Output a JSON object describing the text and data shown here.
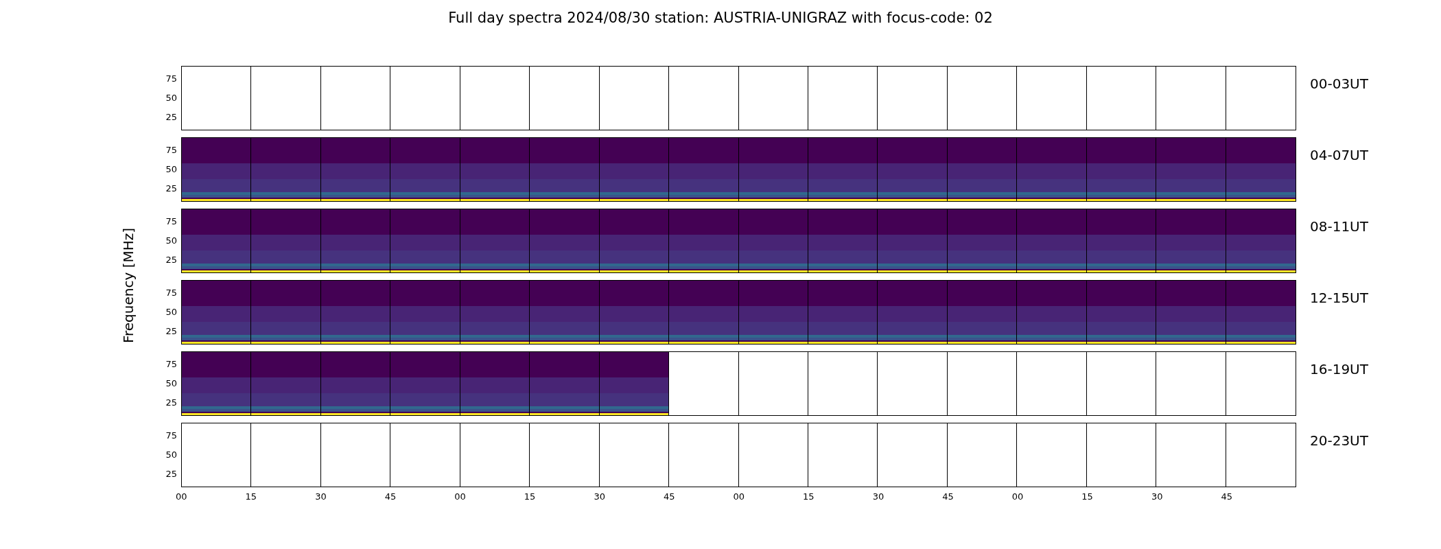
{
  "title": "Full day spectra 2024/08/30 station: AUSTRIA-UNIGRAZ with focus-code: 02",
  "ylabel": "Frequency [MHz]",
  "rows": [
    {
      "label": "00-03UT",
      "yticks": [
        "75",
        "50",
        "25"
      ],
      "panels": [
        {
          "kind": "empty"
        },
        {
          "kind": "empty"
        },
        {
          "kind": "empty"
        },
        {
          "kind": "empty"
        },
        {
          "kind": "empty"
        },
        {
          "kind": "empty"
        },
        {
          "kind": "empty"
        },
        {
          "kind": "empty"
        },
        {
          "kind": "empty"
        },
        {
          "kind": "empty"
        },
        {
          "kind": "empty"
        },
        {
          "kind": "empty"
        },
        {
          "kind": "empty"
        },
        {
          "kind": "empty"
        },
        {
          "kind": "empty"
        },
        {
          "kind": "empty"
        }
      ]
    },
    {
      "label": "04-07UT",
      "yticks": [
        "75",
        "50",
        "25"
      ],
      "panels": [
        {
          "kind": "spectrum"
        },
        {
          "kind": "spectrum"
        },
        {
          "kind": "spectrum"
        },
        {
          "kind": "spectrum"
        },
        {
          "kind": "spectrum"
        },
        {
          "kind": "spectrum"
        },
        {
          "kind": "spectrum"
        },
        {
          "kind": "spectrum"
        },
        {
          "kind": "spectrum"
        },
        {
          "kind": "spectrum"
        },
        {
          "kind": "spectrum"
        },
        {
          "kind": "spectrum"
        },
        {
          "kind": "spectrum"
        },
        {
          "kind": "spectrum"
        },
        {
          "kind": "spectrum"
        },
        {
          "kind": "spectrum"
        }
      ]
    },
    {
      "label": "08-11UT",
      "yticks": [
        "75",
        "50",
        "25"
      ],
      "panels": [
        {
          "kind": "spectrum"
        },
        {
          "kind": "spectrum"
        },
        {
          "kind": "spectrum"
        },
        {
          "kind": "spectrum"
        },
        {
          "kind": "spectrum"
        },
        {
          "kind": "spectrum"
        },
        {
          "kind": "spectrum"
        },
        {
          "kind": "spectrum"
        },
        {
          "kind": "spectrum"
        },
        {
          "kind": "spectrum"
        },
        {
          "kind": "spectrum"
        },
        {
          "kind": "spectrum"
        },
        {
          "kind": "spectrum"
        },
        {
          "kind": "spectrum"
        },
        {
          "kind": "spectrum"
        },
        {
          "kind": "spectrum"
        }
      ]
    },
    {
      "label": "12-15UT",
      "yticks": [
        "75",
        "50",
        "25"
      ],
      "panels": [
        {
          "kind": "spectrum"
        },
        {
          "kind": "spectrum"
        },
        {
          "kind": "spectrum"
        },
        {
          "kind": "spectrum"
        },
        {
          "kind": "spectrum"
        },
        {
          "kind": "spectrum"
        },
        {
          "kind": "spectrum"
        },
        {
          "kind": "spectrum"
        },
        {
          "kind": "spectrum"
        },
        {
          "kind": "spectrum"
        },
        {
          "kind": "spectrum"
        },
        {
          "kind": "spectrum"
        },
        {
          "kind": "spectrum"
        },
        {
          "kind": "spectrum"
        },
        {
          "kind": "spectrum"
        },
        {
          "kind": "spectrum"
        }
      ]
    },
    {
      "label": "16-19UT",
      "yticks": [
        "75",
        "50",
        "25"
      ],
      "panels": [
        {
          "kind": "spectrum"
        },
        {
          "kind": "spectrum"
        },
        {
          "kind": "spectrum"
        },
        {
          "kind": "spectrum"
        },
        {
          "kind": "spectrum"
        },
        {
          "kind": "spectrum"
        },
        {
          "kind": "spectrum"
        },
        {
          "kind": "empty"
        },
        {
          "kind": "empty"
        },
        {
          "kind": "empty"
        },
        {
          "kind": "empty"
        },
        {
          "kind": "empty"
        },
        {
          "kind": "empty"
        },
        {
          "kind": "empty"
        },
        {
          "kind": "empty"
        },
        {
          "kind": "empty"
        }
      ]
    },
    {
      "label": "20-23UT",
      "yticks": [
        "75",
        "50",
        "25"
      ],
      "panels": [
        {
          "kind": "empty"
        },
        {
          "kind": "empty"
        },
        {
          "kind": "empty"
        },
        {
          "kind": "empty"
        },
        {
          "kind": "empty"
        },
        {
          "kind": "empty"
        },
        {
          "kind": "empty"
        },
        {
          "kind": "empty"
        },
        {
          "kind": "empty"
        },
        {
          "kind": "empty"
        },
        {
          "kind": "empty"
        },
        {
          "kind": "empty"
        },
        {
          "kind": "empty"
        },
        {
          "kind": "empty"
        },
        {
          "kind": "empty"
        },
        {
          "kind": "empty"
        }
      ]
    }
  ],
  "xticks": [
    "00",
    "15",
    "30",
    "45",
    "00",
    "15",
    "30",
    "45",
    "00",
    "15",
    "30",
    "45",
    "00",
    "15",
    "30",
    "45"
  ]
}
